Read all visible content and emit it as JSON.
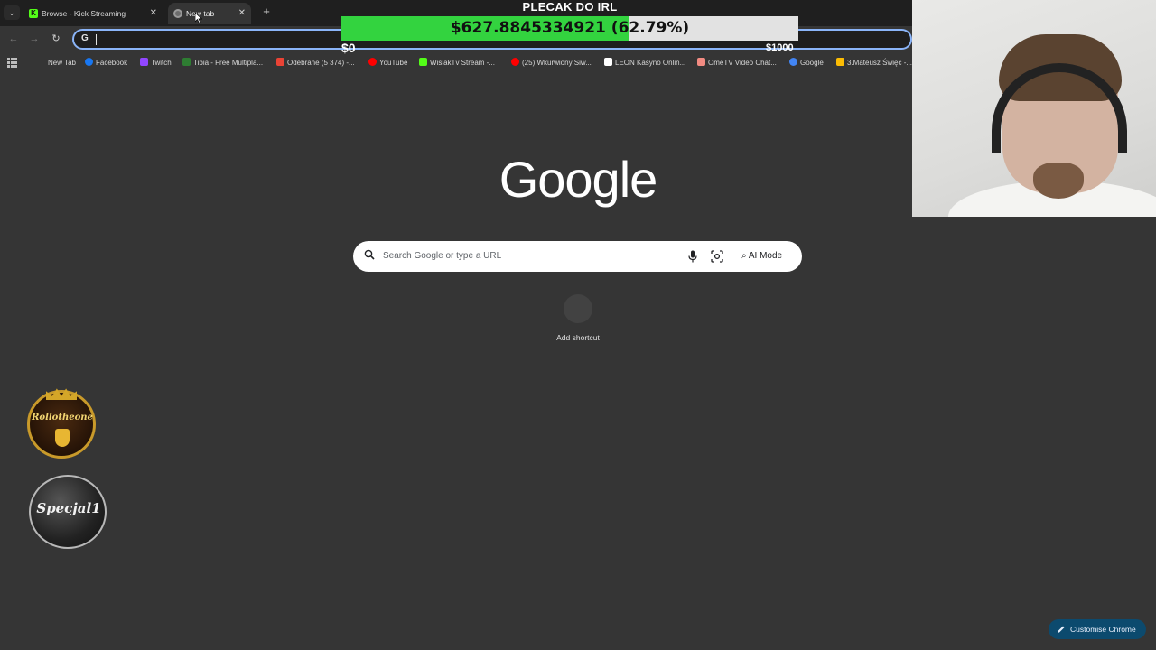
{
  "tabs": [
    {
      "label": "Browse - Kick Streaming",
      "favicon": "kick-icon",
      "active": false
    },
    {
      "label": "New tab",
      "favicon": "chrome-icon",
      "active": true
    }
  ],
  "omnibox": {
    "value": "",
    "provider_icon": "G"
  },
  "bookmarks": [
    {
      "label": "New Tab",
      "icon": "none"
    },
    {
      "label": "Facebook",
      "icon": "facebook-icon",
      "color": "#1877f2"
    },
    {
      "label": "Twitch",
      "icon": "twitch-icon",
      "color": "#9146ff"
    },
    {
      "label": "Tibia - Free Multipla...",
      "icon": "tibia-icon",
      "color": "#2e7d32"
    },
    {
      "label": "Odebrane (5 374) -...",
      "icon": "gmail-icon",
      "color": "#ea4335"
    },
    {
      "label": "YouTube",
      "icon": "youtube-icon",
      "color": "#ff0000"
    },
    {
      "label": "WislakTv Stream -...",
      "icon": "kick-icon",
      "color": "#53fc18"
    },
    {
      "label": "(25) Wkurwiony Siw...",
      "icon": "youtube-icon",
      "color": "#ff0000"
    },
    {
      "label": "LEON Kasyno Onlin...",
      "icon": "leon-icon",
      "color": "#ffffff"
    },
    {
      "label": "OmeTV Video Chat...",
      "icon": "ometv-icon",
      "color": "#f28b82"
    },
    {
      "label": "Google",
      "icon": "google-icon",
      "color": "#4285f4"
    },
    {
      "label": "3.Mateusz Święć -...",
      "icon": "drive-icon",
      "color": "#fbbc04"
    }
  ],
  "overlay": {
    "title": "PLECAK DO IRL",
    "progress_text": "$627.8845334921 (62.79%)",
    "progress_fraction": 0.6279,
    "min_label": "$0",
    "max_label": "$1000",
    "fill_color": "#33d33f"
  },
  "ntp": {
    "logo": "Google",
    "search_placeholder": "Search Google or type a URL",
    "ai_mode_label": "AI Mode",
    "shortcut_label": "Add shortcut",
    "customise_label": "Customise Chrome"
  },
  "badges": {
    "badge1_text": "Rollotheone",
    "badge2_text": "Specjal1"
  }
}
